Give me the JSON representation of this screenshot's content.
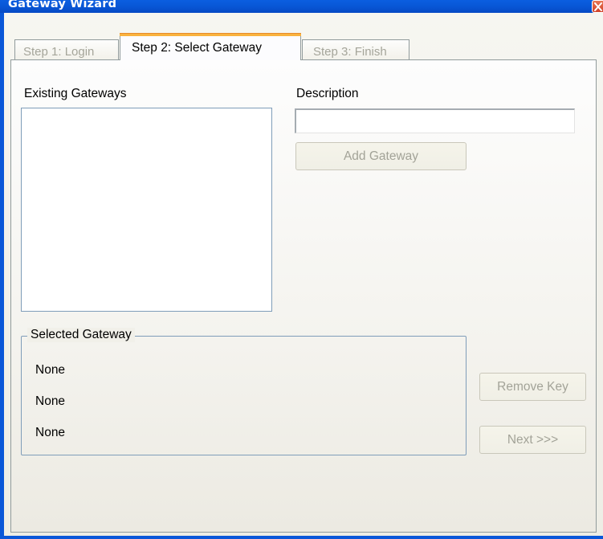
{
  "window": {
    "title": "Gateway Wizard"
  },
  "tabs": [
    {
      "label": "Step 1: Login",
      "state": "disabled"
    },
    {
      "label": "Step 2: Select Gateway",
      "state": "selected"
    },
    {
      "label": "Step 3: Finish",
      "state": "disabled"
    }
  ],
  "existing_gateways": {
    "label": "Existing Gateways",
    "items": []
  },
  "description": {
    "label": "Description",
    "value": ""
  },
  "buttons": {
    "add_gateway": "Add Gateway",
    "remove_key": "Remove Key",
    "next": "Next >>>"
  },
  "selected_gateway": {
    "legend": "Selected Gateway",
    "lines": [
      "None",
      "None",
      "None"
    ]
  },
  "colors": {
    "titlebar": "#0857d6",
    "selected_tab_accent": "#f9b23e",
    "disabled_text": "#a3a398",
    "border": "#7f9db9"
  }
}
